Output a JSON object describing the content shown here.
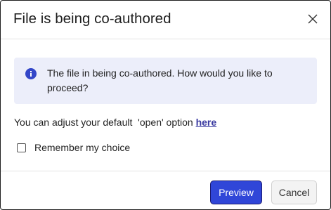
{
  "dialog": {
    "title": "File is being co-authored",
    "close_icon": "close-icon"
  },
  "info": {
    "icon": "info-icon",
    "message": "The file in being co-authored. How would you like to proceed?"
  },
  "adjust": {
    "text": "You can adjust your default  'open' option ",
    "link_label": "here"
  },
  "remember": {
    "label": "Remember my choice",
    "checked": false
  },
  "footer": {
    "preview_label": "Preview",
    "cancel_label": "Cancel"
  },
  "colors": {
    "primary_button": "#3046d8",
    "info_background": "#eceefa",
    "info_icon": "#3346c8",
    "link": "#3a3aa0"
  }
}
